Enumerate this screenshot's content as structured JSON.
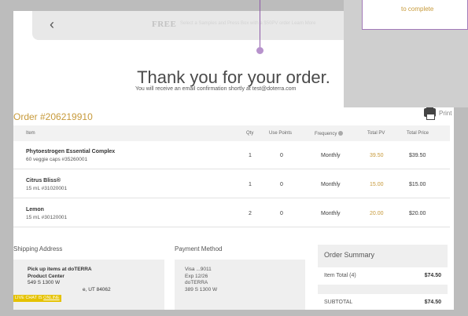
{
  "banner": {
    "back_glyph": "‹",
    "free_label": "FREE",
    "blurred_text": "Select a Samples and Press Box with a $50PV order  Learn More"
  },
  "heading": "Thank you for your order.",
  "confirm_text": "You will receive an email confirmation shortly at test@doterra.com",
  "order_number": "Order #206219910",
  "print_label": "Print",
  "table": {
    "headers": {
      "item": "Item",
      "qty": "Qty",
      "use_points": "Use Points",
      "frequency": "Frequency",
      "total_pv": "Total PV",
      "total_price": "Total Price"
    },
    "rows": [
      {
        "name": "Phytoestrogen Essential Complex",
        "sub": "60 veggie caps #35260001",
        "qty": "1",
        "use_points": "0",
        "frequency": "Monthly",
        "pv": "39.50",
        "price": "$39.50"
      },
      {
        "name": "Citrus Bliss®",
        "sub": "15 mL #31020001",
        "qty": "1",
        "use_points": "0",
        "frequency": "Monthly",
        "pv": "15.00",
        "price": "$15.00"
      },
      {
        "name": "Lemon",
        "sub": "15 mL #30120001",
        "qty": "2",
        "use_points": "0",
        "frequency": "Monthly",
        "pv": "20.00",
        "price": "$20.00"
      }
    ]
  },
  "shipping": {
    "title": "Shipping Address",
    "line1": "Pick up items at doTERRA",
    "line2": "Product Center",
    "line3": "549 S 1300 W",
    "line4": "e, UT 84062"
  },
  "payment": {
    "title": "Payment Method",
    "line1": "Visa ...9011",
    "line2": "Exp 12/26",
    "line3": "doTERRA",
    "line4": "389 S 1300 W"
  },
  "summary": {
    "title": "Order Summary",
    "item_total_label": "Item Total (4)",
    "item_total_value": "$74.50",
    "subtotal_label": "SUBTOTAL",
    "subtotal_value": "$74.50"
  },
  "chat": {
    "prefix": "LIVE CHAT IS ",
    "status": "ONLINE"
  },
  "overlay_text": "to complete",
  "colors": {
    "accent_gold": "#c79a3b",
    "callout_purple": "#8e5aa8",
    "chat_yellow": "#e5c200"
  }
}
